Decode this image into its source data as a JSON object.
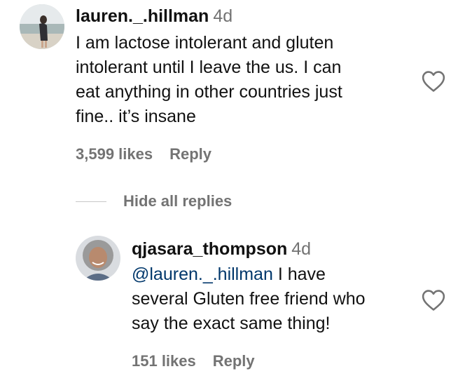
{
  "comments": [
    {
      "username": "lauren._.hillman",
      "time": "4d",
      "text": "I am lactose intolerant and gluten\nintolerant until I leave the us. I can\neat anything in other countries just\nfine.. it’s insane",
      "likes": "3,599 likes",
      "reply_label": "Reply",
      "avatar_icon": "profile-photo-beach"
    }
  ],
  "replies_toggle": {
    "label": "Hide all replies"
  },
  "replies": [
    {
      "username": "qjasara_thompson",
      "time": "4d",
      "mention": "@lauren._.hillman",
      "text_line1": " I have",
      "text_rest": "several Gluten free friend who\nsay the exact same thing!",
      "likes": "151 likes",
      "reply_label": "Reply",
      "avatar_icon": "profile-photo-woman"
    }
  ],
  "colors": {
    "text": "#111111",
    "secondary": "#737373",
    "mention": "#00376b",
    "divider": "#c7c7c7"
  },
  "icons": {
    "like": "heart-outline-icon"
  }
}
